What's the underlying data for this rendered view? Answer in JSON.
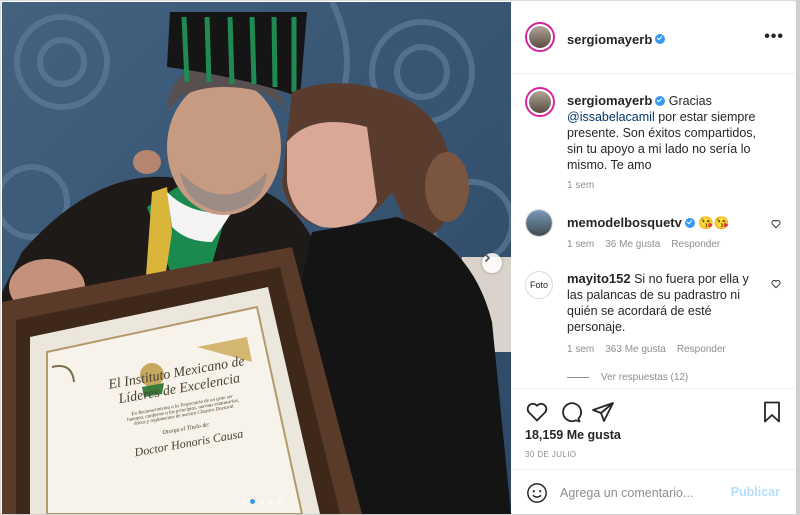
{
  "post": {
    "username": "sergiomayerb",
    "more_label": "•••"
  },
  "caption": {
    "username": "sergiomayerb",
    "text_before": "Gracias ",
    "mention": "@issabelacamil",
    "text_after": " por estar siempre presente. Son éxitos compartidos, sin tu apoyo a mi lado no sería lo mismo. Te amo",
    "time": "1 sem"
  },
  "comments": [
    {
      "username": "memodelbosquetv",
      "verified": true,
      "text": "😘😘",
      "time": "1 sem",
      "likes": "36 Me gusta",
      "reply": "Responder"
    },
    {
      "username": "mayito152",
      "verified": false,
      "avatar_text": "Foto",
      "text": "Si no fuera por ella y las palancas de su padrastro ni quién se acordará de esté personaje.",
      "time": "1 sem",
      "likes": "363 Me gusta",
      "reply": "Responder",
      "view_replies": "Ver respuestas (12)"
    }
  ],
  "stats": {
    "likes": "18,159 Me gusta",
    "date": "30 DE JULIO"
  },
  "composer": {
    "placeholder": "Agrega un comentario...",
    "publish": "Publicar"
  },
  "photo": {
    "diploma_line1": "El Instituto Mexicano de",
    "diploma_line2": "Líderes de Excelencia",
    "diploma_line3": "En Reconocimiento a la Trayectoria de un gran ser",
    "diploma_line4": "humano, conforme a los principios, normas estatutarias,",
    "diploma_line5": "éticas y reglamentos de nuestro Claustro Doctoral",
    "diploma_line6": "Otorga el Título de:",
    "diploma_title": "Doctor Honoris Causa",
    "carousel_dots": 5,
    "active_dot": 1
  },
  "colors": {
    "link": "#00376b",
    "verified": "#3897f0",
    "muted": "#8e8e8e",
    "text": "#262626",
    "publish_disabled": "#b2dffc"
  }
}
